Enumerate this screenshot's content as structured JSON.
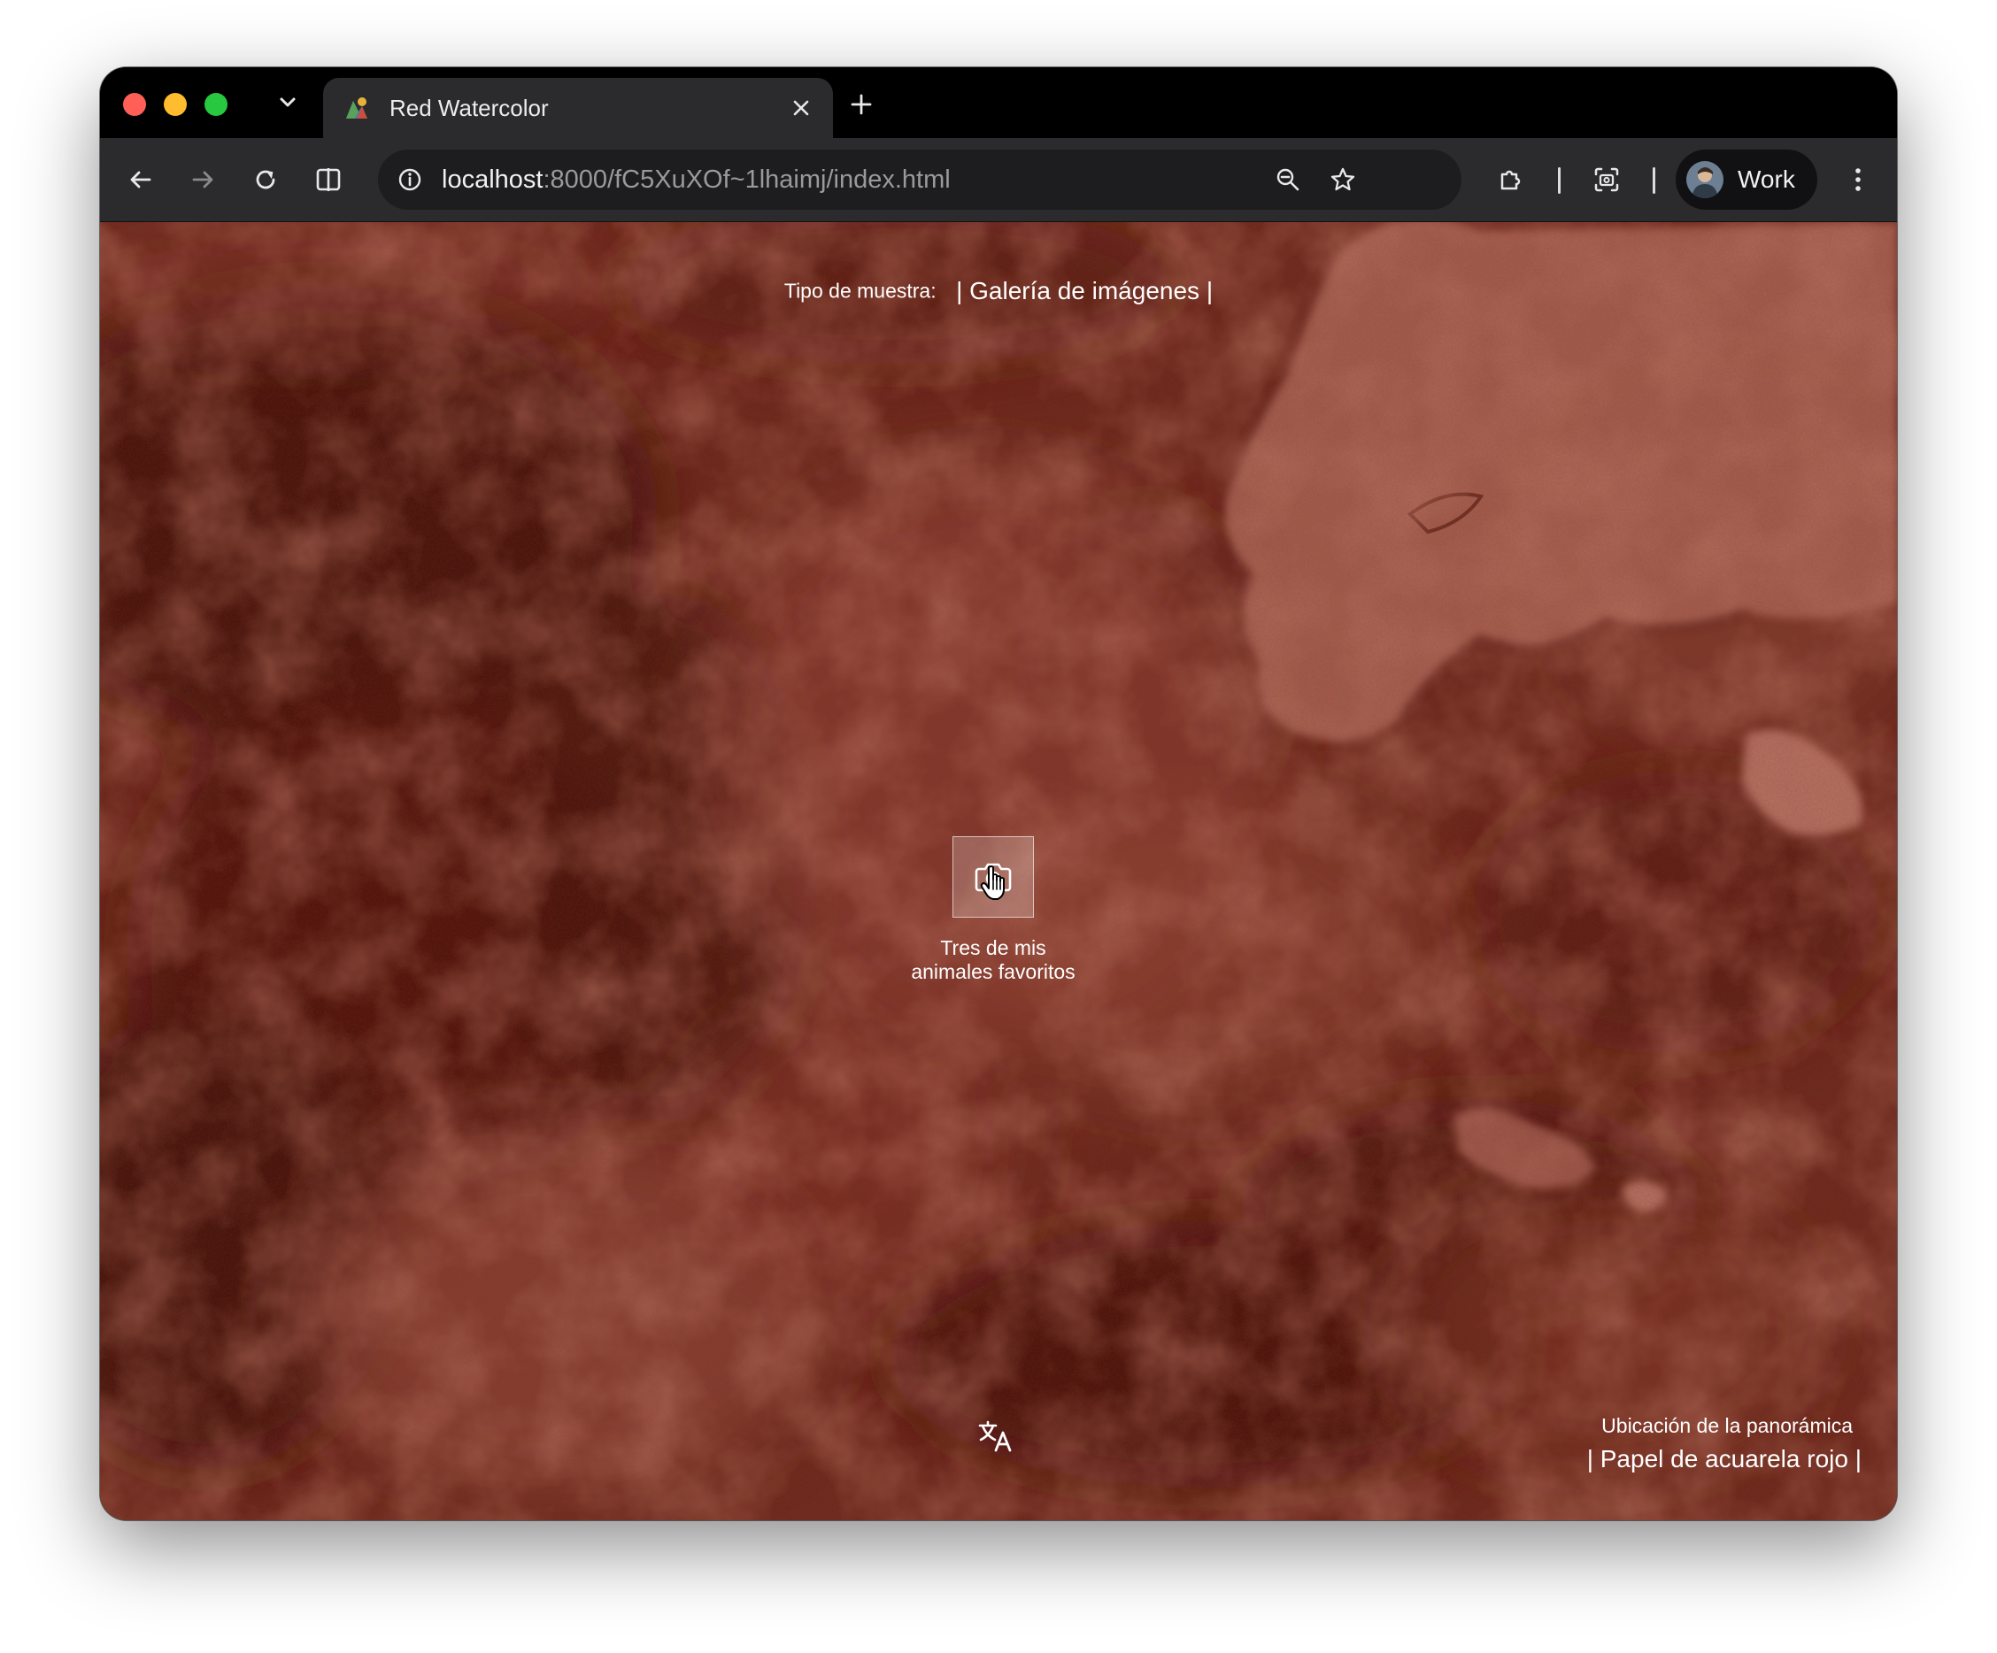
{
  "browser": {
    "tab": {
      "title": "Red Watercolor",
      "favicon": "pano-favicon-icon"
    },
    "url": {
      "host": "localhost",
      "rest": ":8000/fC5XuXOf~1lhaimj/index.html"
    },
    "profile": {
      "name": "Work"
    }
  },
  "page": {
    "sample_type": {
      "label": "Tipo de muestra:",
      "value": "| Galería de imágenes |"
    },
    "hotspot": {
      "icon": "camera-icon",
      "caption_line1": "Tres de mis",
      "caption_line2": "animales favoritos"
    },
    "pano_location": {
      "label": "Ubicación de la panorámica",
      "value": "| Papel de acuarela rojo |"
    },
    "translate_icon": "translate-icon"
  },
  "colors": {
    "tab_strip": "#000000",
    "toolbar": "#2b2b2d",
    "omnibox": "#1d1d1f",
    "watercolor_dark": "#4a140e",
    "watercolor_mid": "#7a3226",
    "watercolor_light": "#a05c50"
  }
}
